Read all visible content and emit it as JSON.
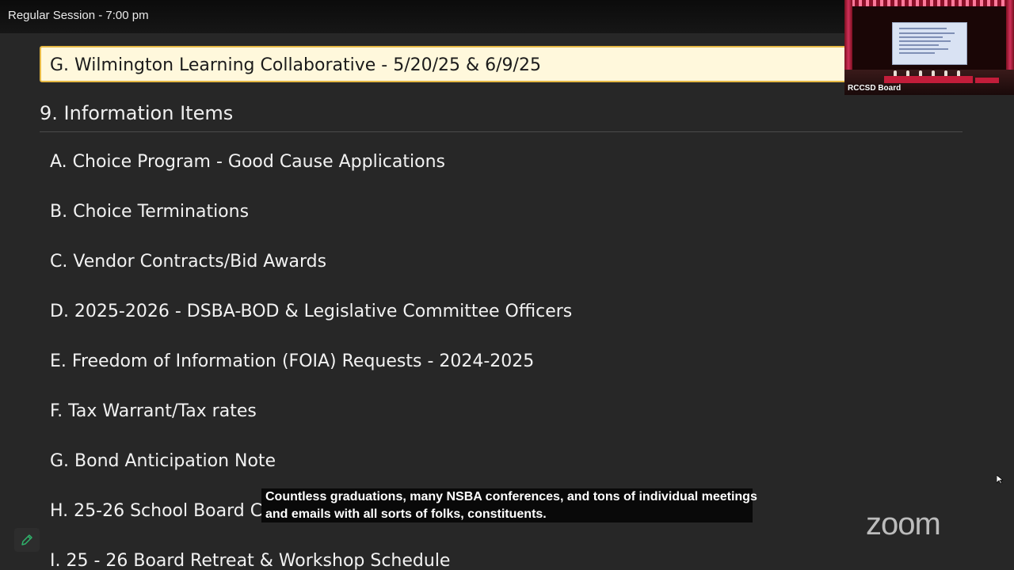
{
  "window": {
    "title": "Regular Session - 7:00 pm"
  },
  "agenda": {
    "highlighted_item": "G. Wilmington Learning Collaborative - 5/20/25 & 6/9/25",
    "section_heading": "9. Information Items",
    "items": [
      {
        "label": "A. Choice Program - Good Cause Applications"
      },
      {
        "label": "B. Choice Terminations"
      },
      {
        "label": "C. Vendor Contracts/Bid Awards"
      },
      {
        "label": "D. 2025-2026 - DSBA-BOD & Legislative Committee Officers"
      },
      {
        "label": "E. Freedom of Information (FOIA) Requests - 2024-2025"
      },
      {
        "label": "F. Tax Warrant/Tax rates"
      },
      {
        "label": "G. Bond Anticipation Note"
      },
      {
        "label": "H. 25-26 School Board C"
      },
      {
        "label": "I. 25 - 26 Board Retreat & Workshop Schedule"
      }
    ]
  },
  "video_tile": {
    "participant_name": "RCCSD Board"
  },
  "caption": {
    "line1": "Countless graduations, many NSBA conferences, and tons of individual meetings",
    "line2": "and emails with all sorts of folks, constituents."
  },
  "branding": {
    "logo_text": "zoom"
  },
  "colors": {
    "background": "#272727",
    "highlight_fill": "#fff8dc",
    "highlight_border": "#e6b945",
    "annotate_icon": "#2fb36b"
  },
  "icons": {
    "annotate": "pencil-icon",
    "cursor": "mouse-pointer-icon"
  }
}
